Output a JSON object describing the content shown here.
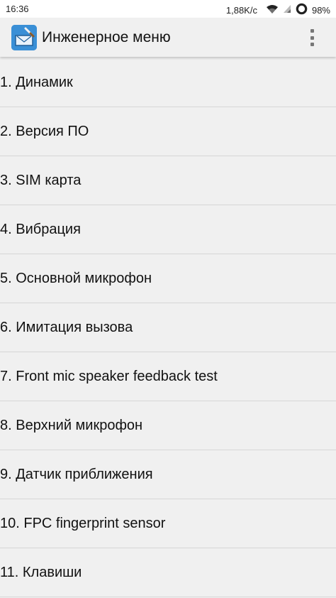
{
  "status_bar": {
    "time": "16:36",
    "speed": "1,88K/c",
    "battery_percent": "98%",
    "icons": [
      "wifi-icon",
      "signal-icon",
      "battery-ring-icon"
    ]
  },
  "app_bar": {
    "title": "Инженерное меню",
    "icon": "engineer-app-icon",
    "menu_icon": "overflow-menu-icon"
  },
  "list": {
    "items": [
      "1. Динамик",
      "2. Версия ПО",
      "3. SIM карта",
      "4. Вибрация",
      "5. Основной микрофон",
      "6. Имитация вызова",
      "7. Front mic speaker feedback test",
      "8. Верхний микрофон",
      "9. Датчик приближения",
      "10. FPC fingerprint sensor",
      "11. Клавиши"
    ]
  },
  "colors": {
    "background": "#f0f0f0",
    "divider": "#d6d6d6",
    "app_icon": "#3a8fd6",
    "text": "#111111"
  }
}
